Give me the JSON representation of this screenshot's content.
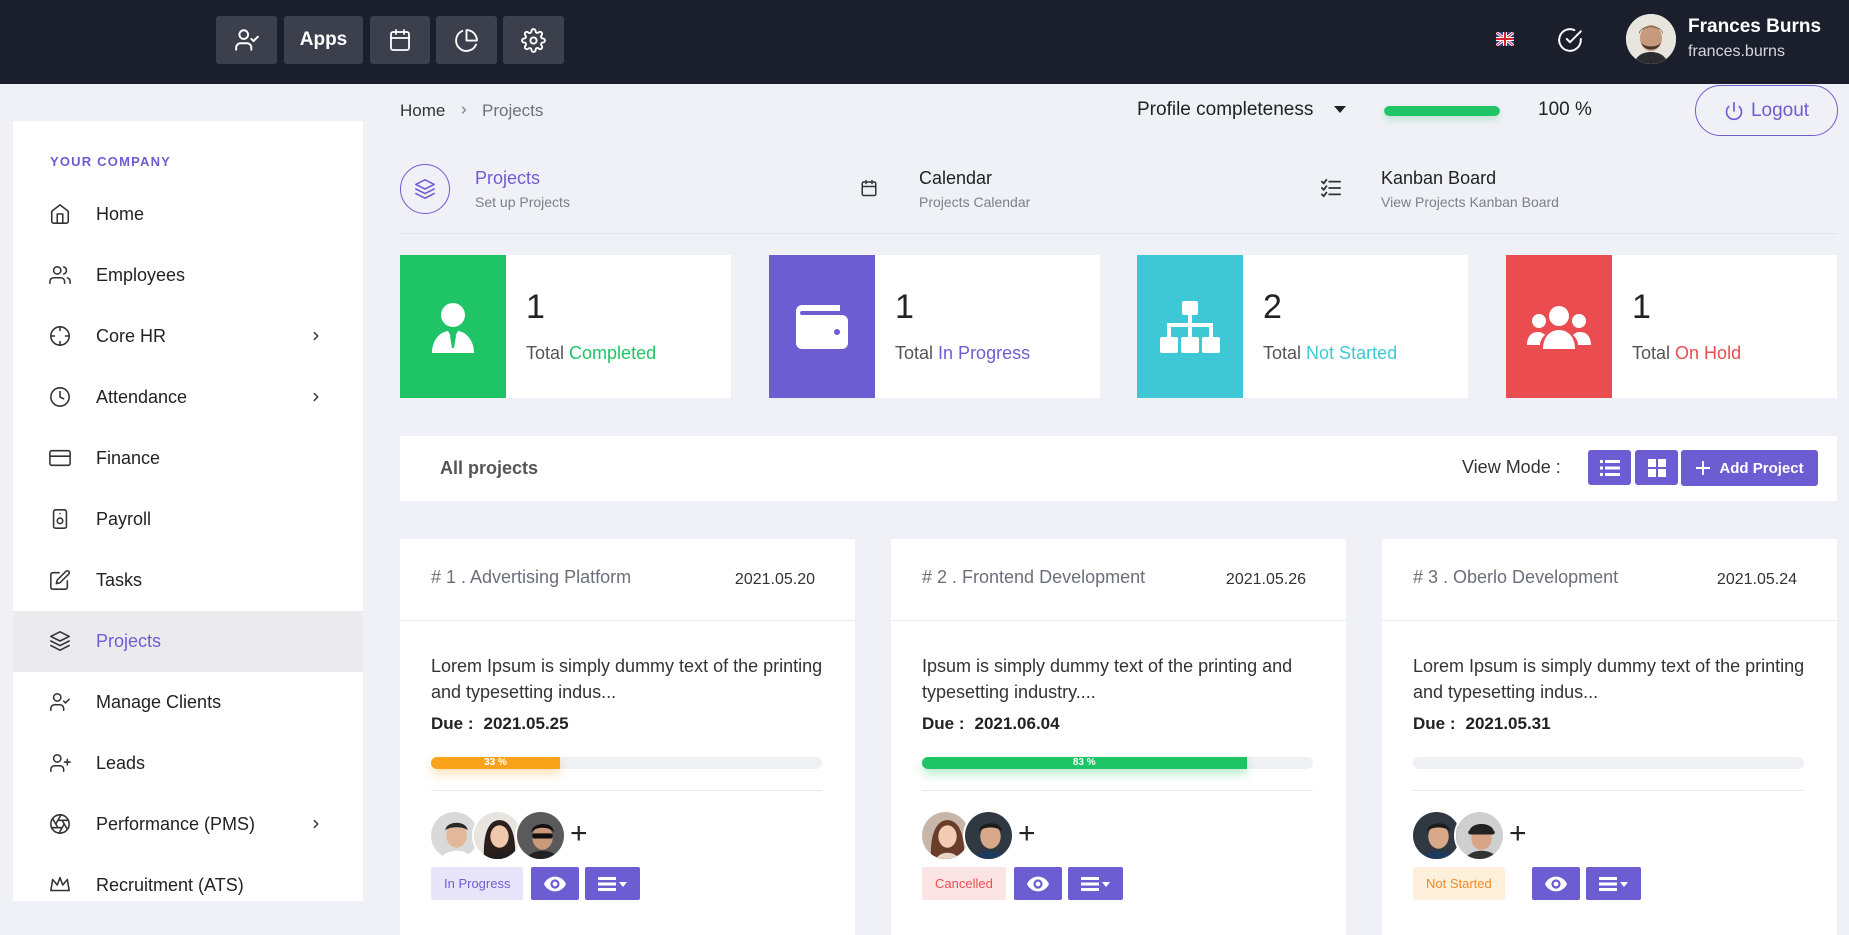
{
  "topbar": {
    "apps_label": "Apps",
    "user": {
      "name": "Frances Burns",
      "login": "frances.burns"
    }
  },
  "sidebar": {
    "company": "YOUR COMPANY",
    "items": [
      {
        "label": "Home",
        "icon": "home-icon"
      },
      {
        "label": "Employees",
        "icon": "users-icon"
      },
      {
        "label": "Core HR",
        "icon": "crosshair-icon",
        "has_children": true
      },
      {
        "label": "Attendance",
        "icon": "clock-icon",
        "has_children": true
      },
      {
        "label": "Finance",
        "icon": "credit-card-icon"
      },
      {
        "label": "Payroll",
        "icon": "safe-icon"
      },
      {
        "label": "Tasks",
        "icon": "edit-icon"
      },
      {
        "label": "Projects",
        "icon": "layers-icon",
        "active": true
      },
      {
        "label": "Manage Clients",
        "icon": "user-check-icon"
      },
      {
        "label": "Leads",
        "icon": "user-plus-icon"
      },
      {
        "label": "Performance (PMS)",
        "icon": "aperture-icon",
        "has_children": true
      },
      {
        "label": "Recruitment (ATS)",
        "icon": "crown-icon"
      }
    ]
  },
  "breadcrumb": {
    "home": "Home",
    "current": "Projects"
  },
  "profile": {
    "label": "Profile completeness",
    "value_text": "100 %",
    "percent": 100
  },
  "logout_label": "Logout",
  "subnav": [
    {
      "title": "Projects",
      "subtitle": "Set up Projects",
      "icon": "layers-icon"
    },
    {
      "title": "Calendar",
      "subtitle": "Projects Calendar",
      "icon": "calendar-icon"
    },
    {
      "title": "Kanban Board",
      "subtitle": "View Projects Kanban Board",
      "icon": "checklist-icon"
    }
  ],
  "stats": [
    {
      "count": "1",
      "prefix": "Total",
      "status": "Completed",
      "color": "#1fc467",
      "icon": "user-tie-icon"
    },
    {
      "count": "1",
      "prefix": "Total",
      "status": "In Progress",
      "color": "#6c5dd3",
      "icon": "wallet-icon"
    },
    {
      "count": "2",
      "prefix": "Total",
      "status": "Not Started",
      "color": "#3ec8d5",
      "icon": "sitemap-icon"
    },
    {
      "count": "1",
      "prefix": "Total",
      "status": "On Hold",
      "color": "#ea4c4f",
      "icon": "users-group-icon"
    }
  ],
  "all_projects": {
    "title": "All projects",
    "view_mode_label": "View Mode :",
    "add_label": "Add Project"
  },
  "projects": [
    {
      "title": "# 1 . Advertising Platform",
      "date": "2021.05.20",
      "description": "Lorem Ipsum is simply dummy text of the printing and typesetting indus...",
      "due_label": "Due :",
      "due": "2021.05.25",
      "progress": 33,
      "progress_text": "33 %",
      "progress_color": "#f9a31a",
      "status": "In Progress",
      "status_bg": "#e8e5fb",
      "status_color": "#6c5dd3"
    },
    {
      "title": "# 2 . Frontend Development",
      "date": "2021.05.26",
      "description": "Ipsum is simply dummy text of the printing and typesetting industry....",
      "due_label": "Due :",
      "due": "2021.06.04",
      "progress": 83,
      "progress_text": "83 %",
      "progress_color": "#1fc467",
      "status": "Cancelled",
      "status_bg": "#fde4e4",
      "status_color": "#ea4c4f"
    },
    {
      "title": "# 3 . Oberlo Development",
      "date": "2021.05.24",
      "description": "Lorem Ipsum is simply dummy text of the printing and typesetting indus...",
      "due_label": "Due :",
      "due": "2021.05.31",
      "progress": 0,
      "progress_text": "",
      "progress_color": "#6c5dd3",
      "status": "Not Started",
      "status_bg": "#fff0dc",
      "status_color": "#f08a24"
    }
  ]
}
